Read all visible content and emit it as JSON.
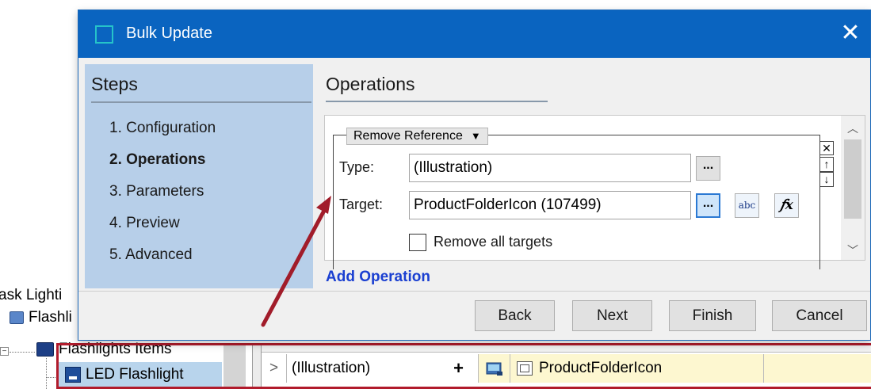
{
  "dialog": {
    "title": "Bulk Update",
    "close_glyph": "✕",
    "steps": {
      "title": "Steps",
      "items": [
        {
          "label": "1. Configuration"
        },
        {
          "label": "2. Operations"
        },
        {
          "label": "3. Parameters"
        },
        {
          "label": "4. Preview"
        },
        {
          "label": "5. Advanced"
        }
      ]
    },
    "operations": {
      "title": "Operations",
      "operation": {
        "kind": "Remove Reference",
        "type_label": "Type:",
        "type_value": "(Illustration)",
        "target_label": "Target:",
        "target_value": "ProductFolderIcon (107499)",
        "browse_label": "...",
        "abc_label": "abc",
        "fx_label": "𝑓x",
        "remove_all_label": "Remove all targets"
      },
      "add_label": "Add Operation"
    },
    "buttons": {
      "back": "Back",
      "next": "Next",
      "finish": "Finish",
      "cancel": "Cancel"
    }
  },
  "background": {
    "tree": {
      "items": [
        {
          "label": "ask Lighti"
        },
        {
          "label": "Flashli"
        },
        {
          "label": "Flashlights Items"
        },
        {
          "label": "LED Flashlight"
        }
      ]
    },
    "grid": {
      "row": {
        "expander": ">",
        "type": "(Illustration)",
        "add": "+",
        "reference": "ProductFolderIcon"
      }
    }
  },
  "colors": {
    "titlebar": "#0a64c0",
    "steps_panel": "#b7cfe9",
    "link": "#1a3fd1",
    "annotation": "#b11b2c"
  }
}
